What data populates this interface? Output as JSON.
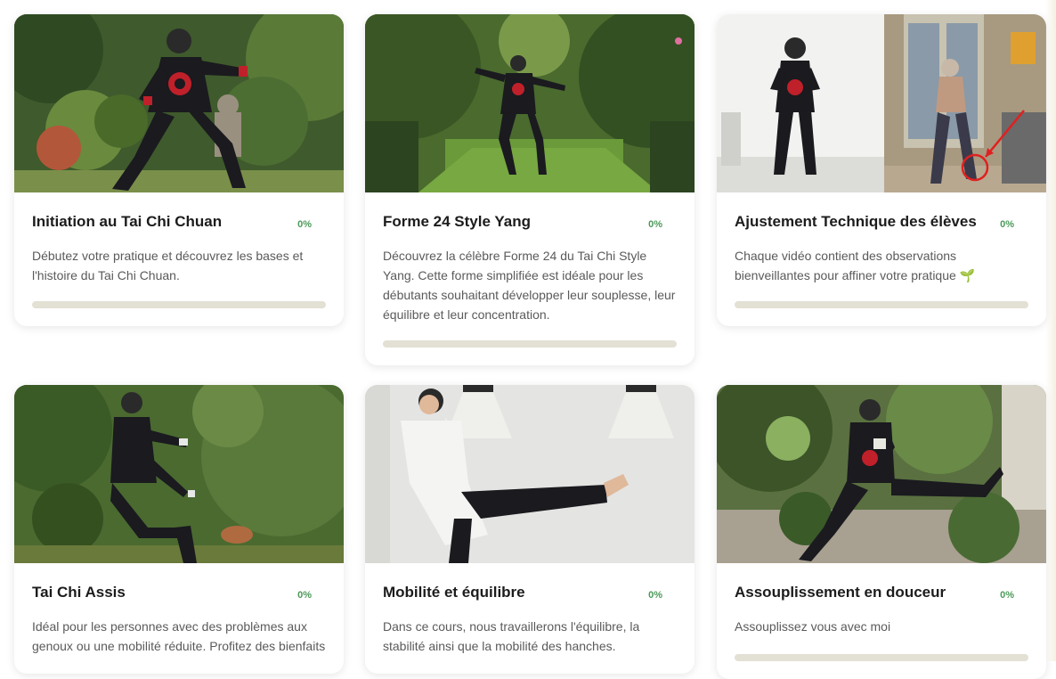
{
  "courses": [
    {
      "title": "Initiation au Tai Chi Chuan",
      "progress_label": "0%",
      "progress": 0,
      "description": "Débutez votre pratique et découvrez les bases et l'histoire du Tai Chi Chuan.",
      "image": "garden-stance-photo"
    },
    {
      "title": "Forme 24 Style Yang",
      "progress_label": "0%",
      "progress": 0,
      "description": "Découvrez la célèbre Forme 24 du Tai Chi Style Yang. Cette forme simplifiée est idéale pour les débutants souhaitant développer leur souplesse, leur équilibre et leur concentration.",
      "image": "garden-lawn-photo"
    },
    {
      "title": "Ajustement Technique des élèves",
      "progress_label": "0%",
      "progress": 0,
      "description": "Chaque vidéo contient des observations bienveillantes pour affiner votre pratique 🌱",
      "image": "split-screen-correction-photo"
    },
    {
      "title": "Tai Chi Assis",
      "progress_label": "0%",
      "progress": 0,
      "description": "Idéal pour les personnes avec des problèmes aux genoux ou une mobilité réduite. Profitez des bienfaits",
      "image": "seated-tai-chi-photo"
    },
    {
      "title": "Mobilité et équilibre",
      "progress_label": "0%",
      "progress": 0,
      "description": "Dans ce cours, nous travaillerons l'équilibre, la stabilité ainsi que la mobilité des hanches.",
      "image": "studio-kick-photo"
    },
    {
      "title": "Assouplissement en douceur",
      "progress_label": "0%",
      "progress": 0,
      "description": "Assouplissez vous avec moi",
      "image": "terrace-stretch-photo"
    }
  ],
  "colors": {
    "accent_green": "#4c9a5a",
    "progress_track": "#e3e0d4",
    "uniform_black": "#1a1a1f",
    "emblem_red": "#c0202a"
  }
}
